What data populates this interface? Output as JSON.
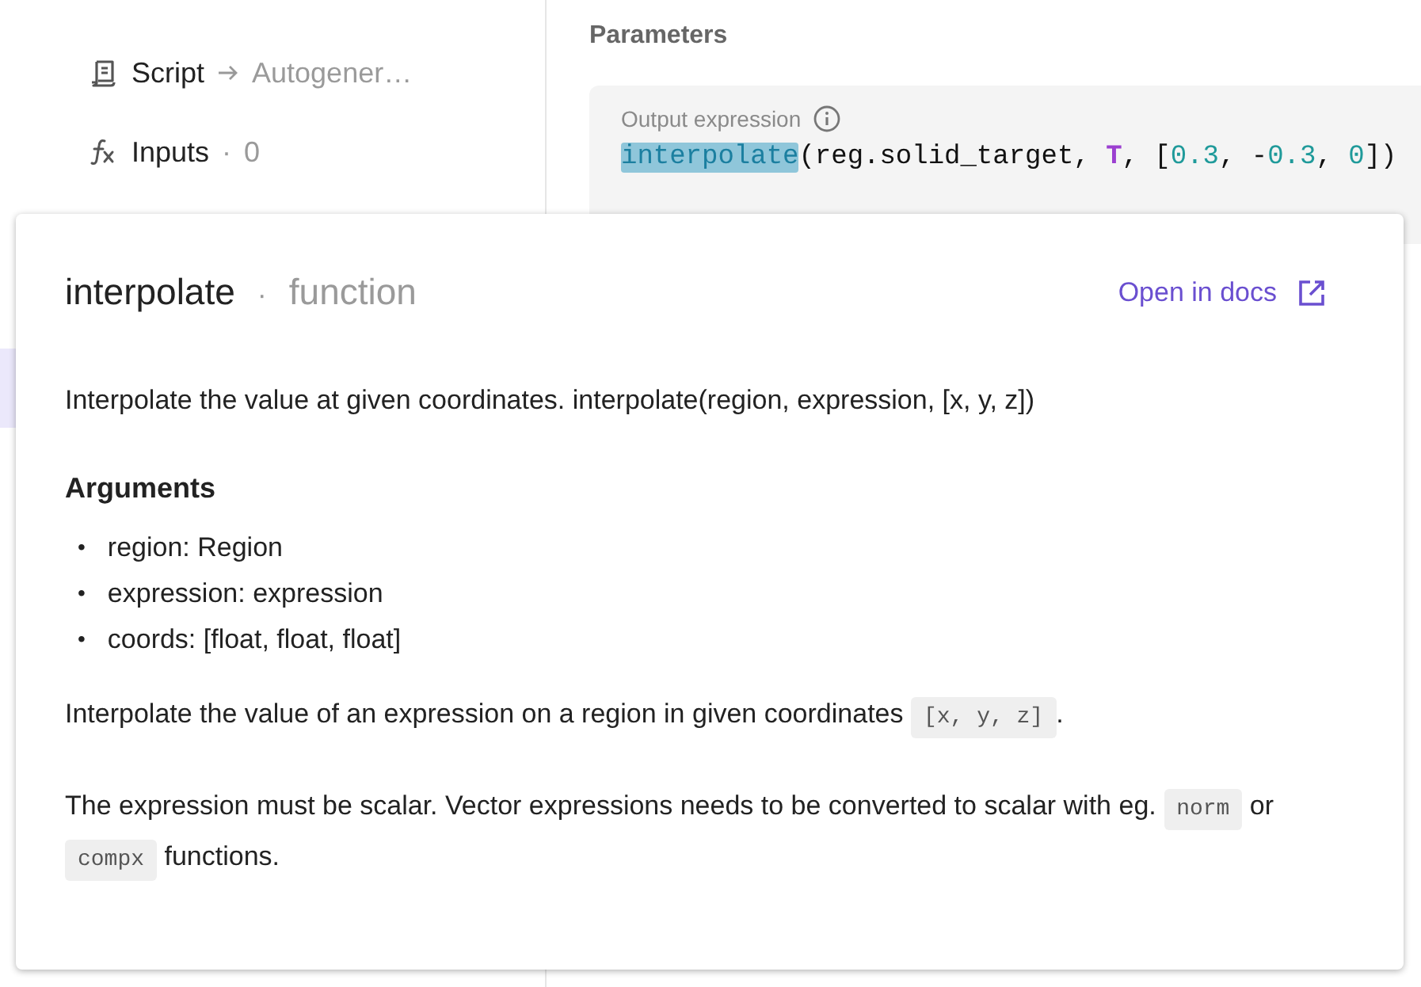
{
  "sidebar": {
    "items": [
      {
        "kind": "script",
        "label": "Script",
        "target": "Autogener…"
      },
      {
        "kind": "inputs",
        "label": "Inputs",
        "separator": "·",
        "count": "0"
      }
    ]
  },
  "parameters": {
    "title": "Parameters",
    "field": {
      "label": "Output expression",
      "tokens": [
        {
          "text": "interpolate",
          "kind": "function",
          "selected": true
        },
        {
          "text": "(reg.solid_target, ",
          "kind": "plain",
          "selected": false
        },
        {
          "text": "T",
          "kind": "variable",
          "selected": false
        },
        {
          "text": ", [",
          "kind": "plain",
          "selected": false
        },
        {
          "text": "0.3",
          "kind": "number",
          "selected": false
        },
        {
          "text": ", -",
          "kind": "plain",
          "selected": false
        },
        {
          "text": "0.3",
          "kind": "number",
          "selected": false
        },
        {
          "text": ", ",
          "kind": "plain",
          "selected": false
        },
        {
          "text": "0",
          "kind": "number",
          "selected": false
        },
        {
          "text": "])",
          "kind": "plain",
          "selected": false
        }
      ]
    }
  },
  "popover": {
    "name": "interpolate",
    "separator": "·",
    "type": "function",
    "link": "Open in docs",
    "summary": "Interpolate the value at given coordinates. interpolate(region, expression, [x, y, z])",
    "arguments_title": "Arguments",
    "arguments": [
      {
        "bullet": "•",
        "text": "region: Region"
      },
      {
        "bullet": "•",
        "text": "expression: expression"
      },
      {
        "bullet": "•",
        "text": "coords: [float, float, float]"
      }
    ],
    "paragraphs": [
      [
        {
          "kind": "text",
          "text": "Interpolate the value of an expression on a region in given coordinates "
        },
        {
          "kind": "code",
          "text": "[x, y, z]"
        },
        {
          "kind": "text",
          "text": "."
        }
      ],
      [
        {
          "kind": "text",
          "text": "The expression must be scalar. Vector expressions needs to be converted to scalar with eg. "
        },
        {
          "kind": "code",
          "text": "norm"
        },
        {
          "kind": "text",
          "text": " or "
        },
        {
          "kind": "code",
          "text": "compx"
        },
        {
          "kind": "text",
          "text": " functions."
        }
      ]
    ]
  }
}
